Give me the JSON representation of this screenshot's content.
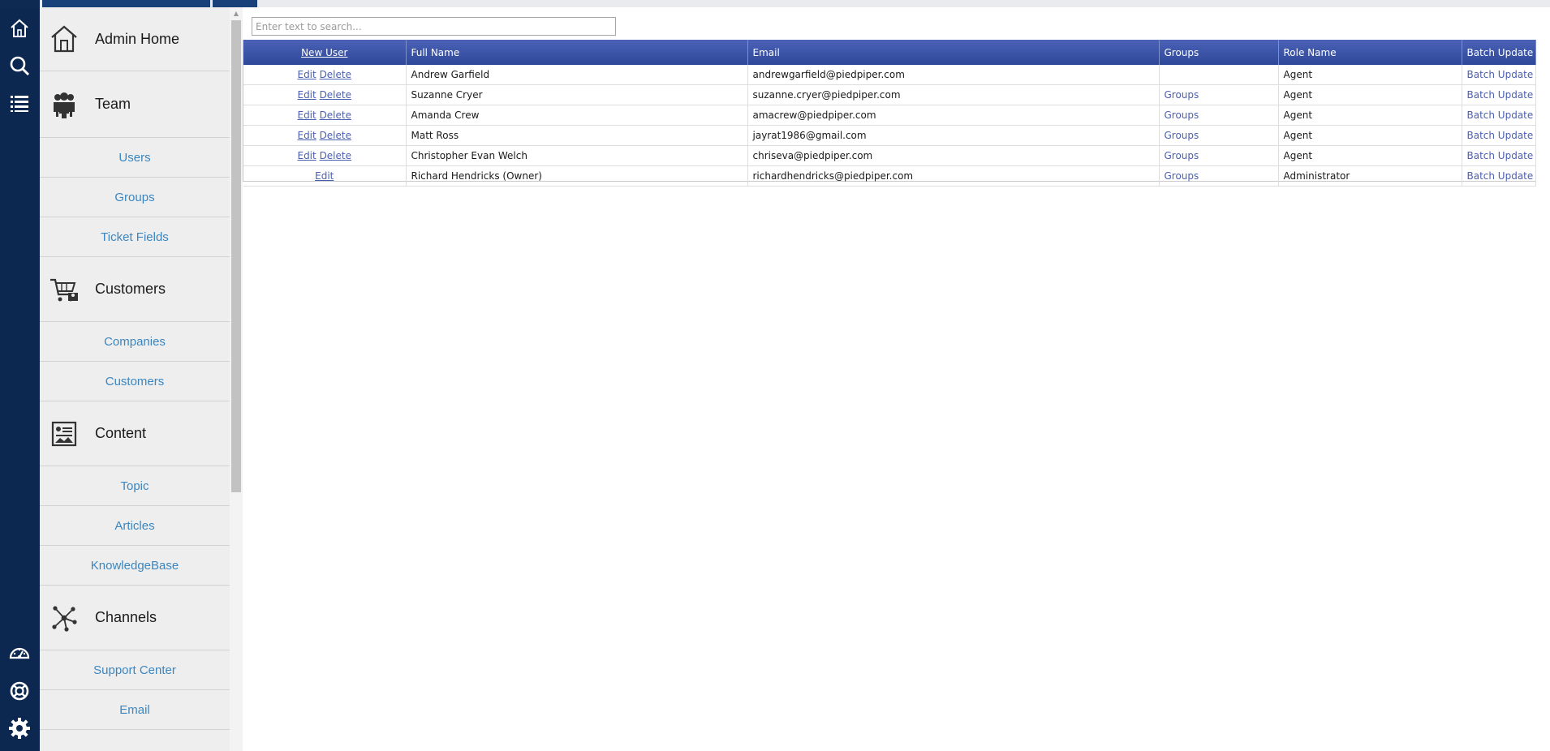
{
  "rail": {
    "icons": [
      "home-icon",
      "search-icon",
      "list-icon",
      "dashboard-icon",
      "lifebuoy-icon",
      "gear-icon"
    ]
  },
  "sidebar": {
    "sections": [
      {
        "label": "Admin Home",
        "icon": "home-outline-icon",
        "items": []
      },
      {
        "label": "Team",
        "icon": "team-icon",
        "items": [
          "Users",
          "Groups",
          "Ticket Fields"
        ]
      },
      {
        "label": "Customers",
        "icon": "cart-icon",
        "items": [
          "Companies",
          "Customers"
        ]
      },
      {
        "label": "Content",
        "icon": "content-icon",
        "items": [
          "Topic",
          "Articles",
          "KnowledgeBase"
        ]
      },
      {
        "label": "Channels",
        "icon": "network-icon",
        "items": [
          "Support Center",
          "Email"
        ]
      }
    ]
  },
  "search": {
    "placeholder": "Enter text to search..."
  },
  "table": {
    "headers": {
      "new_user": "New User",
      "full_name": "Full Name",
      "email": "Email",
      "groups": "Groups",
      "role_name": "Role Name",
      "batch_update": "Batch Update"
    },
    "action_labels": {
      "edit": "Edit",
      "delete": "Delete"
    },
    "rows": [
      {
        "full_name": "Andrew Garfield",
        "email": "andrewgarfield@piedpiper.com",
        "groups": "",
        "role": "Agent",
        "batch": "Batch Update",
        "can_delete": true
      },
      {
        "full_name": "Suzanne Cryer",
        "email": "suzanne.cryer@piedpiper.com",
        "groups": "Groups",
        "role": "Agent",
        "batch": "Batch Update",
        "can_delete": true
      },
      {
        "full_name": "Amanda Crew",
        "email": "amacrew@piedpiper.com",
        "groups": "Groups",
        "role": "Agent",
        "batch": "Batch Update",
        "can_delete": true
      },
      {
        "full_name": "Matt Ross",
        "email": "jayrat1986@gmail.com",
        "groups": "Groups",
        "role": "Agent",
        "batch": "Batch Update",
        "can_delete": true
      },
      {
        "full_name": "Christopher Evan Welch",
        "email": "chriseva@piedpiper.com",
        "groups": "Groups",
        "role": "Agent",
        "batch": "Batch Update",
        "can_delete": true
      },
      {
        "full_name": "Richard Hendricks (Owner)",
        "email": "richardhendricks@piedpiper.com",
        "groups": "Groups",
        "role": "Administrator",
        "batch": "Batch Update",
        "can_delete": false
      }
    ]
  },
  "colors": {
    "rail": "#0d2850",
    "header": "#3a51a5",
    "link": "#4a5fb0",
    "menu_link": "#3b86c0"
  }
}
